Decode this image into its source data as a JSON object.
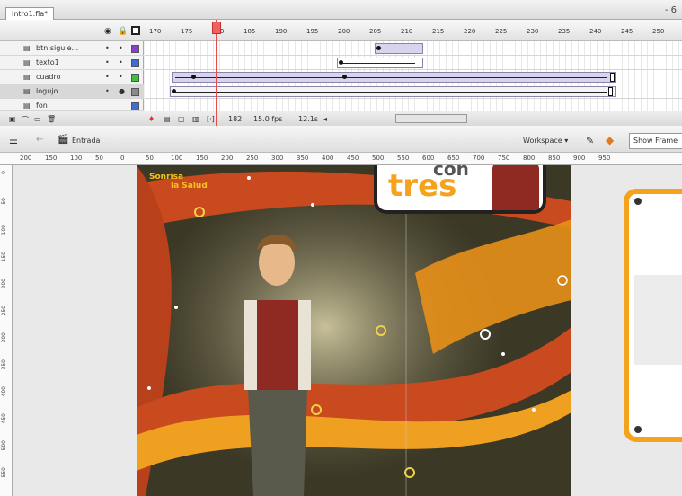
{
  "document": {
    "tab_title": "Intro1.fla*",
    "window_controls": "- 6"
  },
  "timeline": {
    "header_icons": [
      "eye-icon",
      "lock-icon",
      "outline-icon"
    ],
    "ruler": [
      "170",
      "175",
      "180",
      "185",
      "190",
      "195",
      "200",
      "205",
      "210",
      "215",
      "220",
      "225",
      "230",
      "235",
      "240",
      "245",
      "250"
    ],
    "layers": [
      {
        "name": "btn siguie...",
        "color": "#8b3fc9"
      },
      {
        "name": "texto1",
        "color": "#3b6fd8"
      },
      {
        "name": "cuadro",
        "color": "#3bc43b"
      },
      {
        "name": "logujo",
        "color": "#8a8a8a"
      },
      {
        "name": "fon",
        "color": "#3b6fd8"
      }
    ],
    "footer": {
      "current_frame": "182",
      "fps": "15.0 fps",
      "elapsed": "12.1s"
    }
  },
  "editbar": {
    "scene": "Entrada",
    "workspace": "Workspace ▾",
    "show_frame": "Show Frame"
  },
  "rulers": {
    "top": [
      "200",
      "150",
      "100",
      "50",
      "0",
      "50",
      "100",
      "150",
      "200",
      "250",
      "300",
      "350",
      "400",
      "450",
      "500",
      "550",
      "600",
      "650",
      "700",
      "750",
      "800",
      "850",
      "900",
      "950"
    ],
    "left": [
      "0",
      "50",
      "100",
      "150",
      "200",
      "250",
      "300",
      "350",
      "400",
      "450",
      "500",
      "550"
    ]
  },
  "stage": {
    "logo_line1": "Sonrisa",
    "logo_line2": "la Salud",
    "banner_word1": "con",
    "banner_word2": "tres"
  },
  "colors": {
    "accent_orange": "#f5a21c",
    "stage_dark": "#1e1c14",
    "playhead": "#e84a4a"
  }
}
